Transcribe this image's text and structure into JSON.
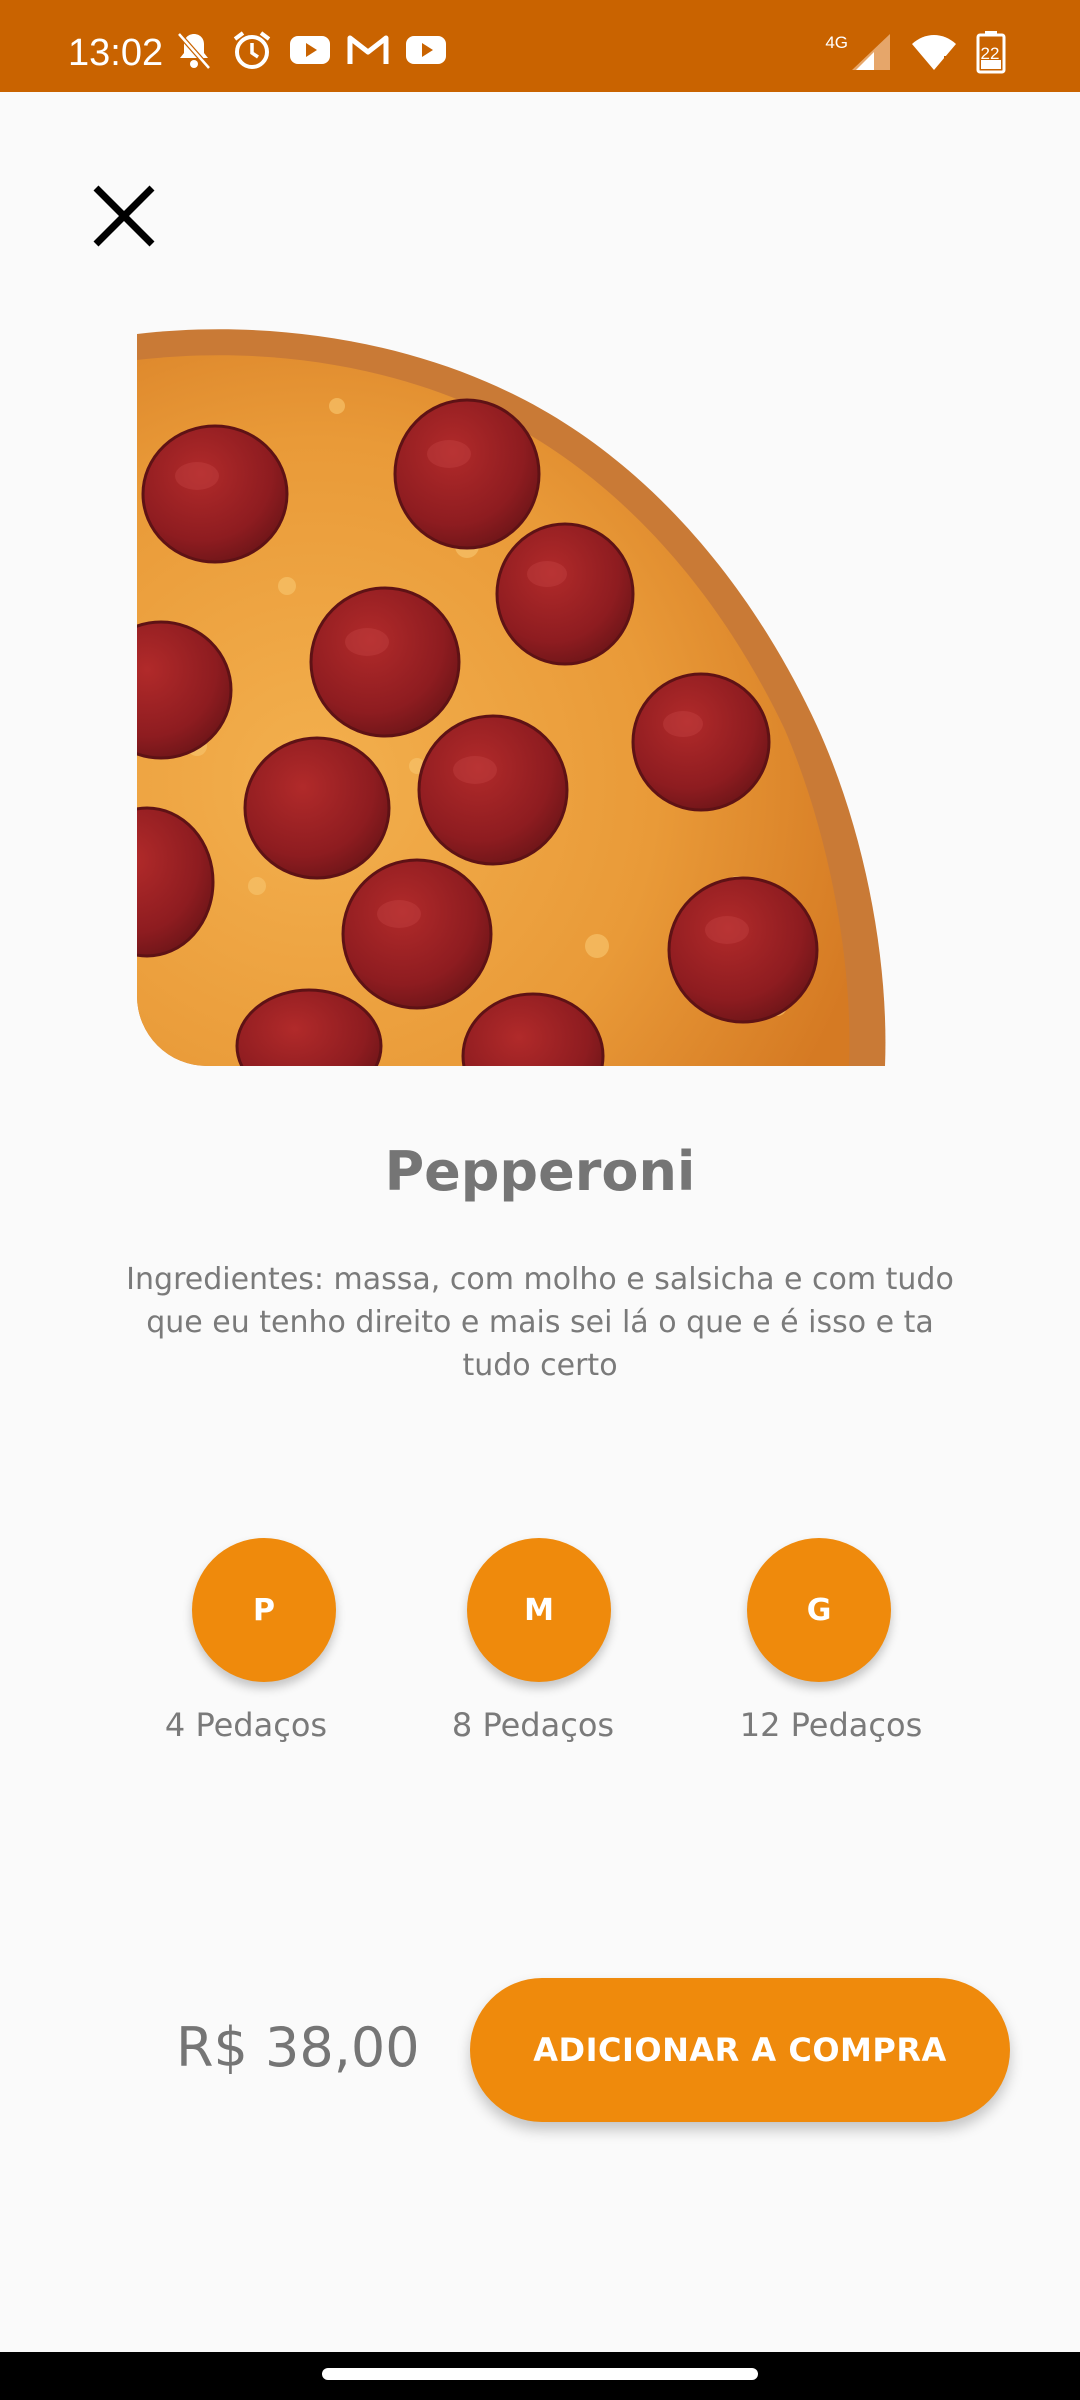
{
  "status_bar": {
    "time": "13:02",
    "network_label": "4G",
    "battery_level": "22",
    "left_icons": [
      "bell-off-icon",
      "alarm-icon",
      "youtube-icon",
      "gmail-icon",
      "youtube-icon"
    ],
    "right_icons": [
      "signal-icon",
      "wifi-icon",
      "battery-icon"
    ],
    "color": "#c96300"
  },
  "header": {
    "close_icon": "close-icon"
  },
  "product": {
    "name": "Pepperoni",
    "description": "Ingredientes: massa, com molho e salsicha e com tudo que eu tenho direito e mais sei lá o que e é isso e ta tudo certo",
    "image": "pepperoni-pizza-slice-image"
  },
  "sizes": [
    {
      "code": "P",
      "label": "4 Pedaços"
    },
    {
      "code": "M",
      "label": "8 Pedaços"
    },
    {
      "code": "G",
      "label": "12 Pedaços"
    }
  ],
  "price": "R$ 38,00",
  "add_button_label": "ADICIONAR A COMPRA",
  "colors": {
    "accent": "#ef8a0c",
    "status_bar": "#c96300",
    "text_gray": "#757575",
    "background": "#fafafa"
  }
}
